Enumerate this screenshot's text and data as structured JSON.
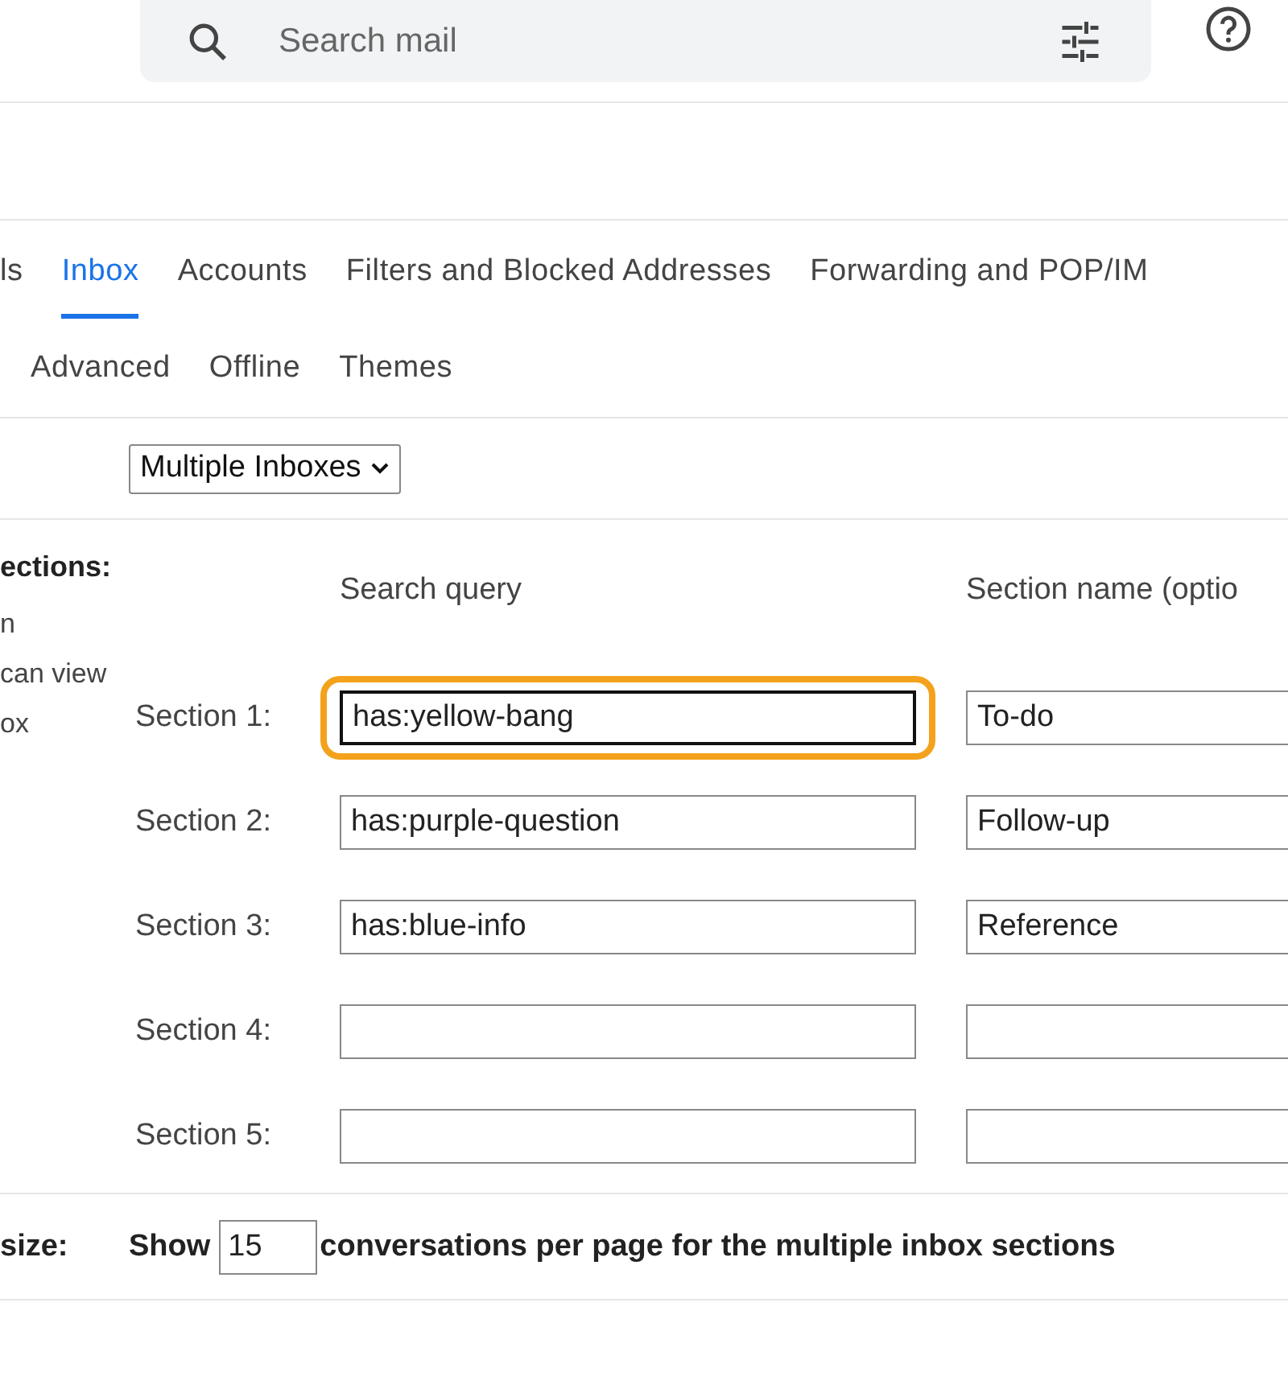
{
  "search": {
    "placeholder": "Search mail"
  },
  "tabs": [
    {
      "label": "ls",
      "selected": false
    },
    {
      "label": "Inbox",
      "selected": true
    },
    {
      "label": "Accounts",
      "selected": false
    },
    {
      "label": "Filters and Blocked Addresses",
      "selected": false
    },
    {
      "label": "Forwarding and POP/IM",
      "selected": false
    }
  ],
  "tabs_row_2": [
    {
      "label": "Advanced",
      "selected": false
    },
    {
      "label": "Offline",
      "selected": false
    },
    {
      "label": "Themes",
      "selected": false
    }
  ],
  "inbox_type": {
    "value": "Multiple Inboxes"
  },
  "sections_help": {
    "title": "ections:",
    "lines": [
      "n",
      "can view",
      "ox"
    ]
  },
  "columns": {
    "query": "Search query",
    "name": "Section name (optio"
  },
  "sections": [
    {
      "label": "Section 1:",
      "query": "has:yellow-bang",
      "name": "To-do",
      "focused": true
    },
    {
      "label": "Section 2:",
      "query": "has:purple-question",
      "name": "Follow-up",
      "focused": false
    },
    {
      "label": "Section 3:",
      "query": "has:blue-info",
      "name": "Reference",
      "focused": false
    },
    {
      "label": "Section 4:",
      "focused": false
    },
    {
      "label": "Section 5:",
      "focused": false
    }
  ],
  "page_size": {
    "label": "size:",
    "before": "Show",
    "value": "15",
    "after": "conversations per page for the multiple inbox sections"
  }
}
